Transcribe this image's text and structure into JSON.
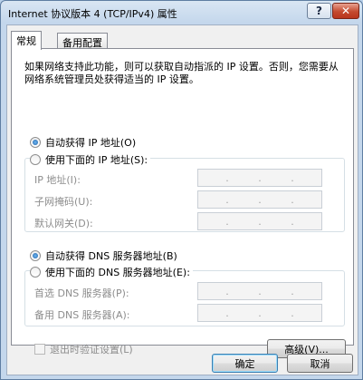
{
  "window": {
    "title": "Internet 协议版本 4 (TCP/IPv4) 属性",
    "help_label": "?",
    "close_label": "✕"
  },
  "tabs": [
    {
      "label": "常规",
      "active": true
    },
    {
      "label": "备用配置",
      "active": false
    }
  ],
  "general": {
    "description": "如果网络支持此功能，则可以获取自动指派的 IP 设置。否则，您需要从网络系统管理员处获得适当的 IP 设置。",
    "ip_auto_label": "自动获得 IP 地址(O)",
    "ip_manual_label": "使用下面的 IP 地址(S):",
    "ip_fields": [
      {
        "label": "IP 地址(I):"
      },
      {
        "label": "子网掩码(U):"
      },
      {
        "label": "默认网关(D):"
      }
    ],
    "dns_auto_label": "自动获得 DNS 服务器地址(B)",
    "dns_manual_label": "使用下面的 DNS 服务器地址(E):",
    "dns_fields": [
      {
        "label": "首选 DNS 服务器(P):"
      },
      {
        "label": "备用 DNS 服务器(A):"
      }
    ],
    "validate_label": "退出时验证设置(L)",
    "advanced_label": "高级(V)...",
    "ip_dot": "."
  },
  "footer": {
    "ok_label": "确定",
    "cancel_label": "取消"
  }
}
